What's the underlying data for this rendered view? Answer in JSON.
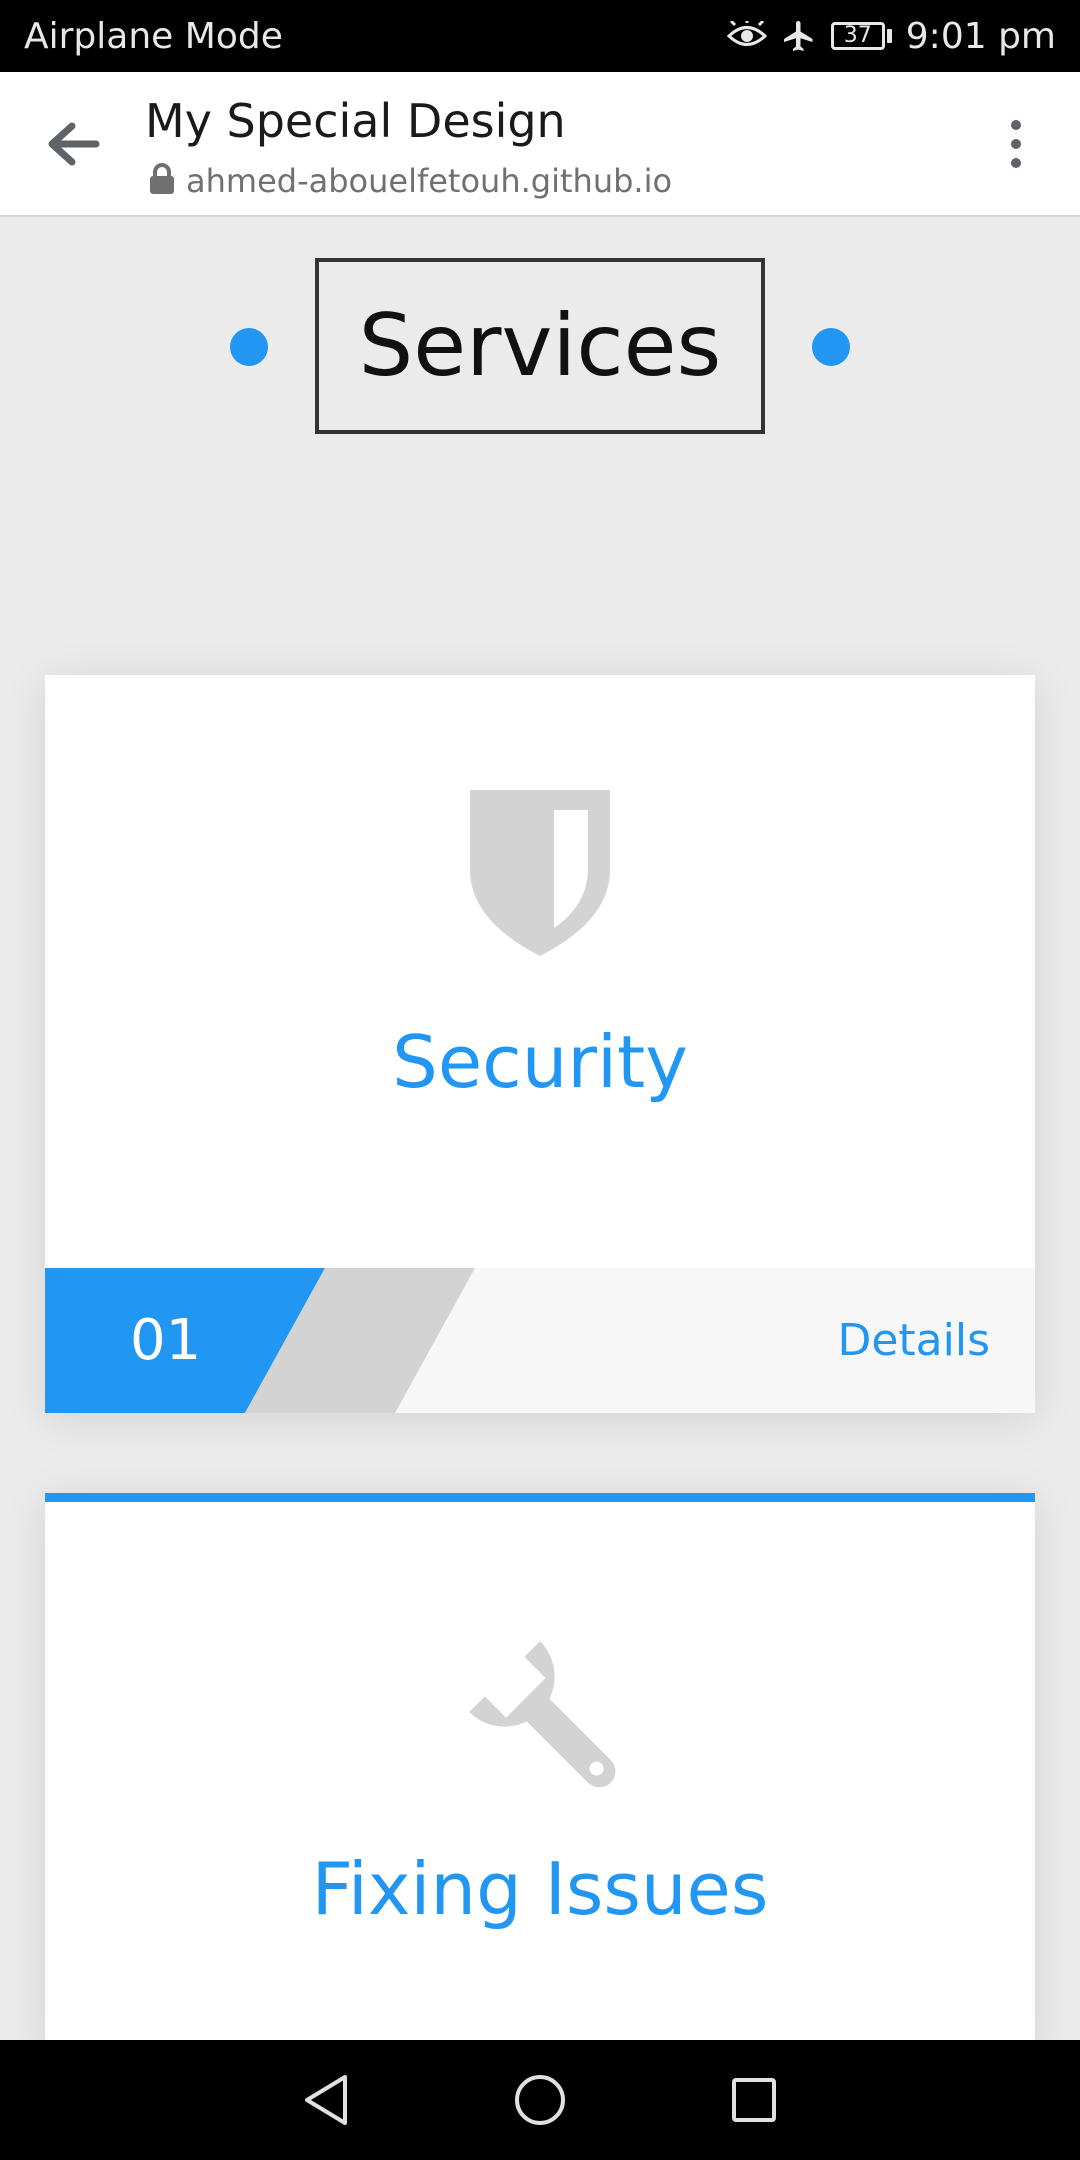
{
  "status_bar": {
    "left_text": "Airplane Mode",
    "battery": "37",
    "time": "9:01 pm",
    "icons": [
      "eye-icon",
      "airplane-icon",
      "battery-icon"
    ]
  },
  "browser": {
    "title": "My Special Design",
    "url": "ahmed-abouelfetouh.github.io",
    "icons": [
      "back-arrow-icon",
      "lock-icon",
      "more-vert-icon"
    ]
  },
  "section": {
    "heading": "Services",
    "accent_color": "#2196f3"
  },
  "cards": [
    {
      "icon": "shield-icon",
      "title": "Security",
      "number": "01",
      "details_label": "Details"
    },
    {
      "icon": "wrench-icon",
      "title": "Fixing Issues"
    }
  ],
  "nav": {
    "icons": [
      "back-triangle-icon",
      "home-circle-icon",
      "recents-square-icon"
    ]
  }
}
